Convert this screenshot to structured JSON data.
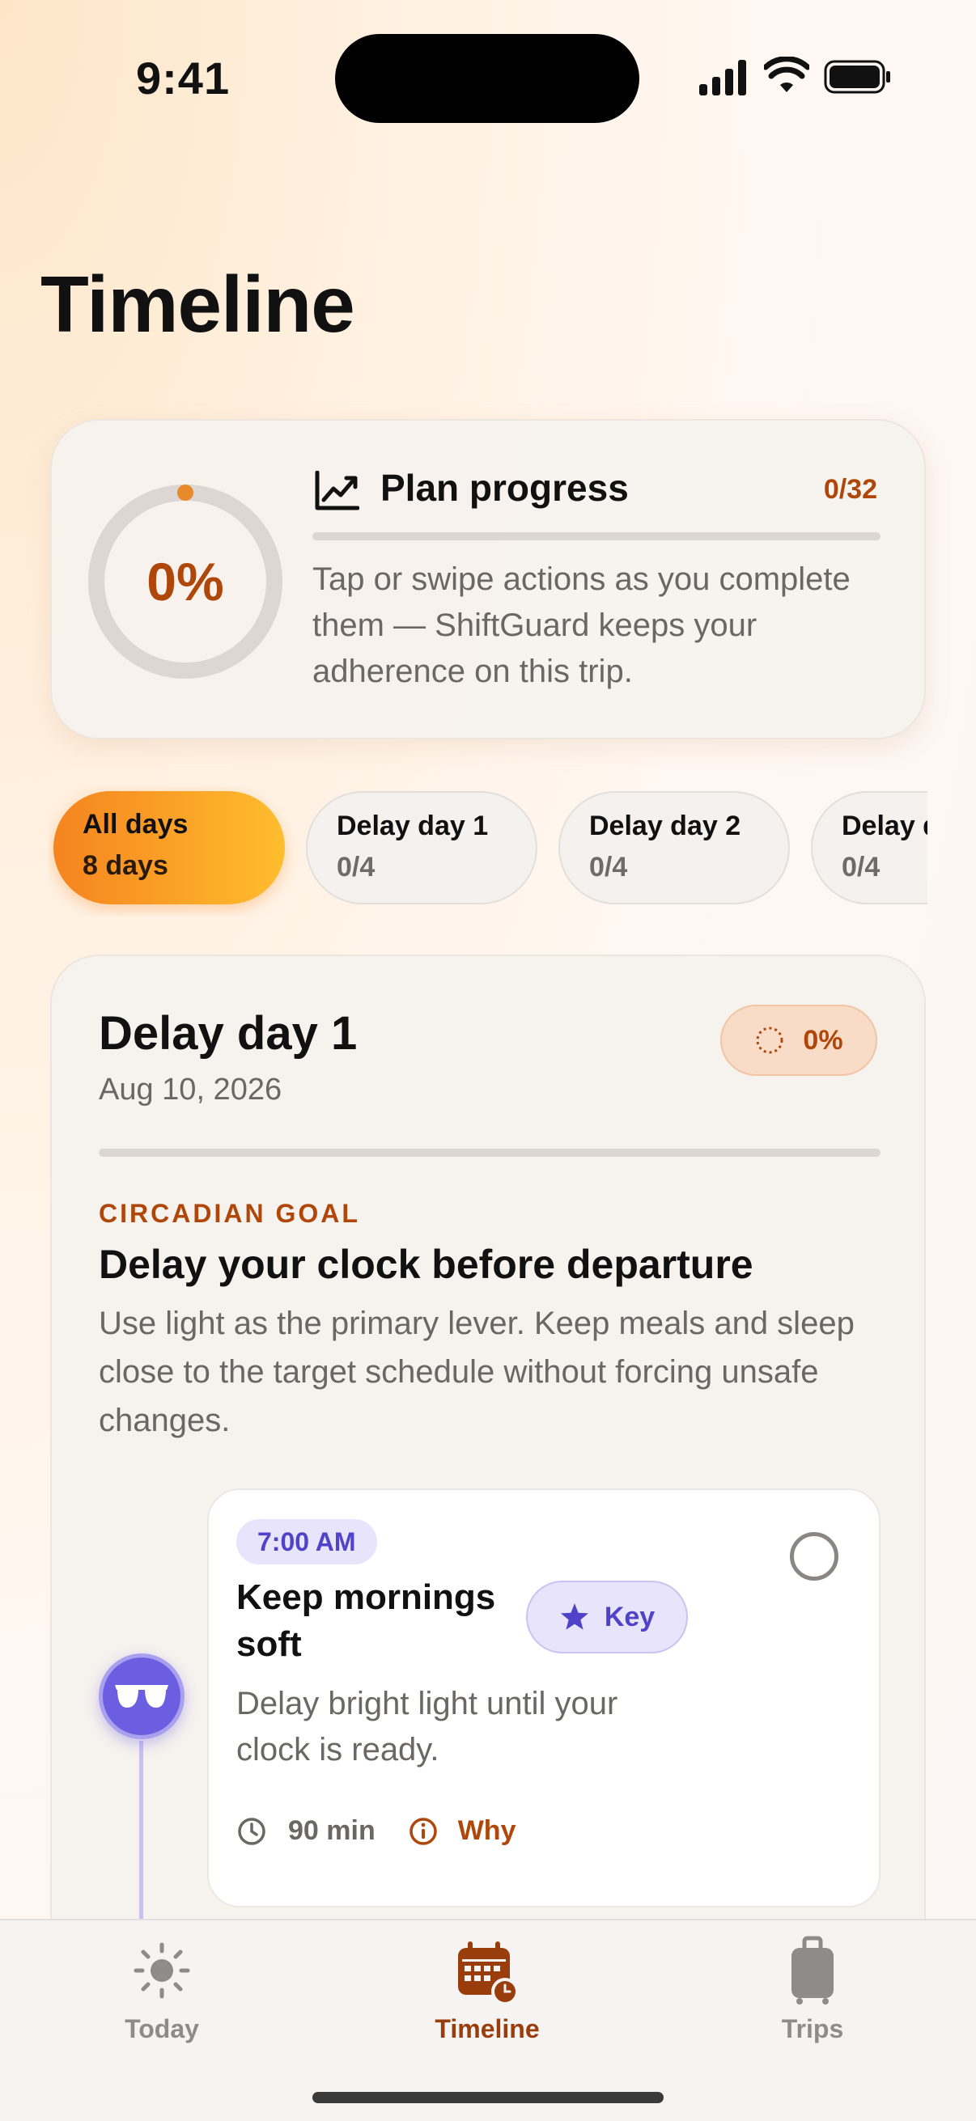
{
  "status_bar": {
    "time": "9:41"
  },
  "header": {
    "title": "Timeline"
  },
  "plan_progress": {
    "percent_label": "0%",
    "progress_fraction": 0,
    "title": "Plan progress",
    "count": "0/32",
    "description": "Tap or swipe actions as you complete them — ShiftGuard keeps your adherence on this trip.",
    "icon": "chart-line-icon"
  },
  "day_filters": [
    {
      "title": "All days",
      "sub": "8 days",
      "active": true
    },
    {
      "title": "Delay day 1",
      "sub": "0/4",
      "active": false
    },
    {
      "title": "Delay day 2",
      "sub": "0/4",
      "active": false
    },
    {
      "title": "Delay d",
      "sub": "0/4",
      "active": false
    }
  ],
  "day_card": {
    "title": "Delay day 1",
    "date": "Aug 10, 2026",
    "badge": "0%",
    "progress_fraction": 0,
    "goal_label": "CIRCADIAN GOAL",
    "goal_title": "Delay your clock before departure",
    "goal_description": "Use light as the primary lever. Keep meals and sleep close to the target schedule without forcing unsafe changes.",
    "actions": [
      {
        "time": "7:00 AM",
        "title": "Keep mornings soft",
        "key_label": "Key",
        "description": "Delay bright light until your clock is ready.",
        "duration": "90 min",
        "why_label": "Why",
        "icon": "sunglasses-icon",
        "completed": false
      }
    ]
  },
  "tab_bar": {
    "tabs": [
      {
        "label": "Today",
        "icon": "sun-icon",
        "active": false
      },
      {
        "label": "Timeline",
        "icon": "calendar-clock-icon",
        "active": true
      },
      {
        "label": "Trips",
        "icon": "suitcase-icon",
        "active": false
      }
    ]
  },
  "colors": {
    "accent": "#b0470a",
    "accent_orange": "#f5841f",
    "purple": "#6b5ee0",
    "muted_text": "#6b6764"
  }
}
